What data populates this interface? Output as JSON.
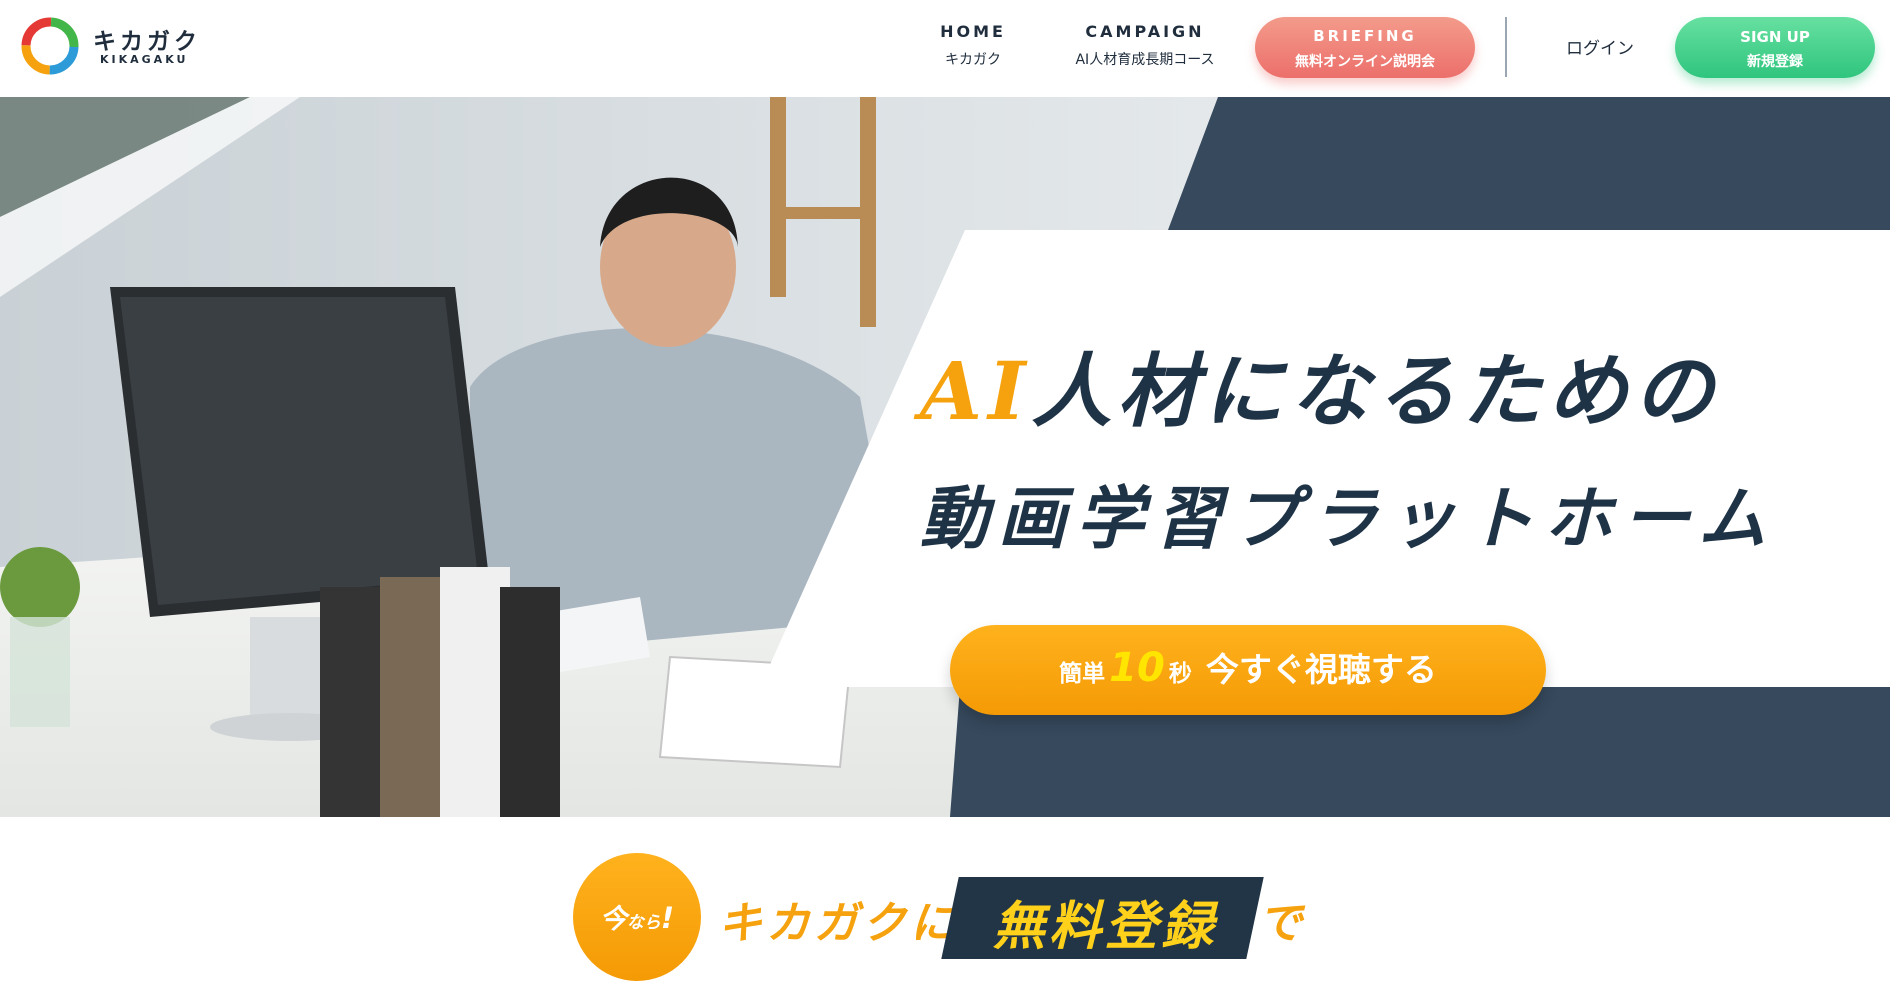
{
  "header": {
    "logo": {
      "name": "キカガク",
      "sub": "KIKAGAKU"
    },
    "nav": [
      {
        "en": "HOME",
        "jp": "キカガク"
      },
      {
        "en": "CAMPAIGN",
        "jp": "AI人材育成長期コース"
      }
    ],
    "briefing": {
      "en": "BRIEFING",
      "jp": "無料オンライン説明会"
    },
    "login": "ログイン",
    "signup": {
      "en": "SIGN UP",
      "jp": "新規登録"
    }
  },
  "hero": {
    "headline_ai": "AI",
    "headline_rest": "人材になるための",
    "headline_line2": "動画学習プラットホーム",
    "cta": {
      "prefix": "簡単",
      "number": "10",
      "unit": "秒",
      "label": "今すぐ視聴する"
    }
  },
  "banner": {
    "badge_a": "今",
    "badge_b": "なら",
    "badge_c": "!",
    "lead": "キカガクに",
    "highlight": "無料登録",
    "tail": "で"
  },
  "colors": {
    "navy": "#223547",
    "orange": "#f5a20e",
    "coral": "#ec6f6b",
    "green": "#2fc57e",
    "yellow": "#ffd11a"
  }
}
